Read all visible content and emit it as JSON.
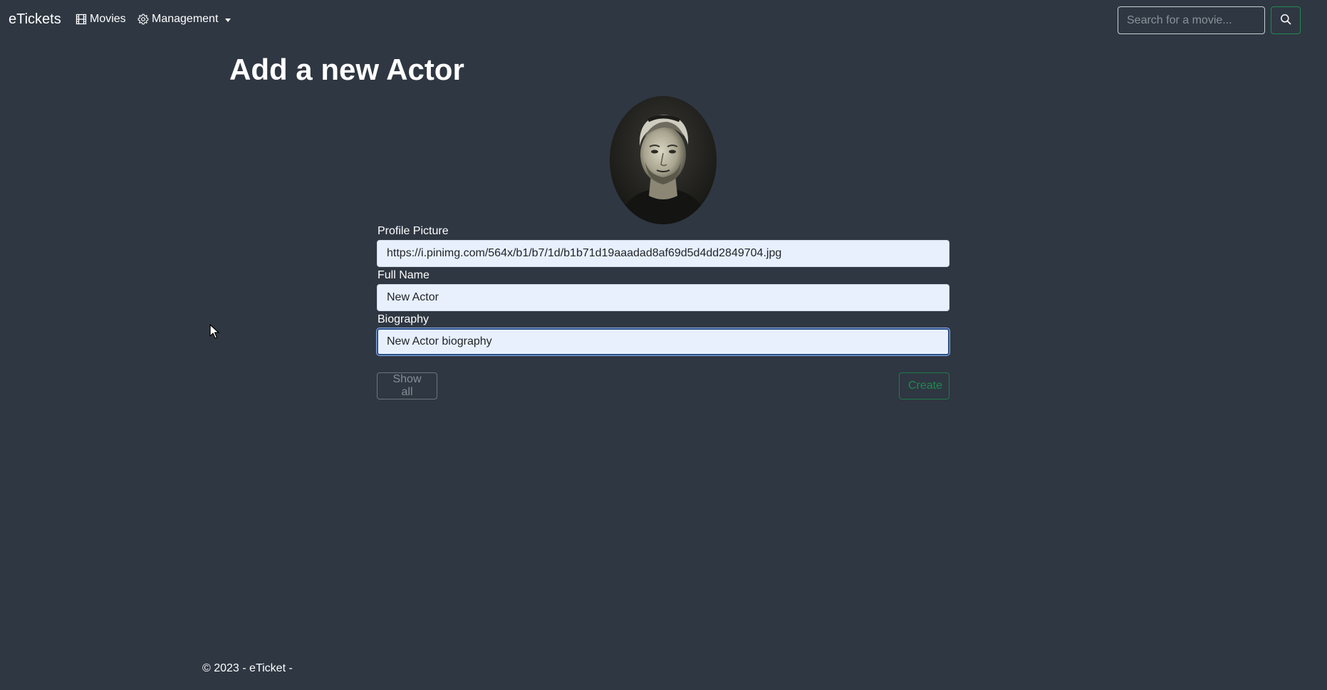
{
  "navbar": {
    "brand": "eTickets",
    "movies_label": "Movies",
    "management_label": "Management",
    "search_placeholder": "Search for a movie..."
  },
  "page": {
    "title": "Add a new Actor"
  },
  "form": {
    "profile_picture_label": "Profile Picture",
    "profile_picture_value": "https://i.pinimg.com/564x/b1/b7/1d/b1b71d19aaadad8af69d5d4dd2849704.jpg",
    "full_name_label": "Full Name",
    "full_name_value": "New Actor",
    "biography_label": "Biography",
    "biography_value": "New Actor biography",
    "show_all_label": "Show all",
    "create_label": "Create"
  },
  "footer": {
    "text": "© 2023 - eTicket -"
  },
  "icons": {
    "movies": "film-icon",
    "management": "gear-icon",
    "search": "search-icon"
  },
  "colors": {
    "background": "#2f3742",
    "input_fill": "#e8f0fe",
    "success": "#1f8a52",
    "secondary": "#6c757d"
  }
}
